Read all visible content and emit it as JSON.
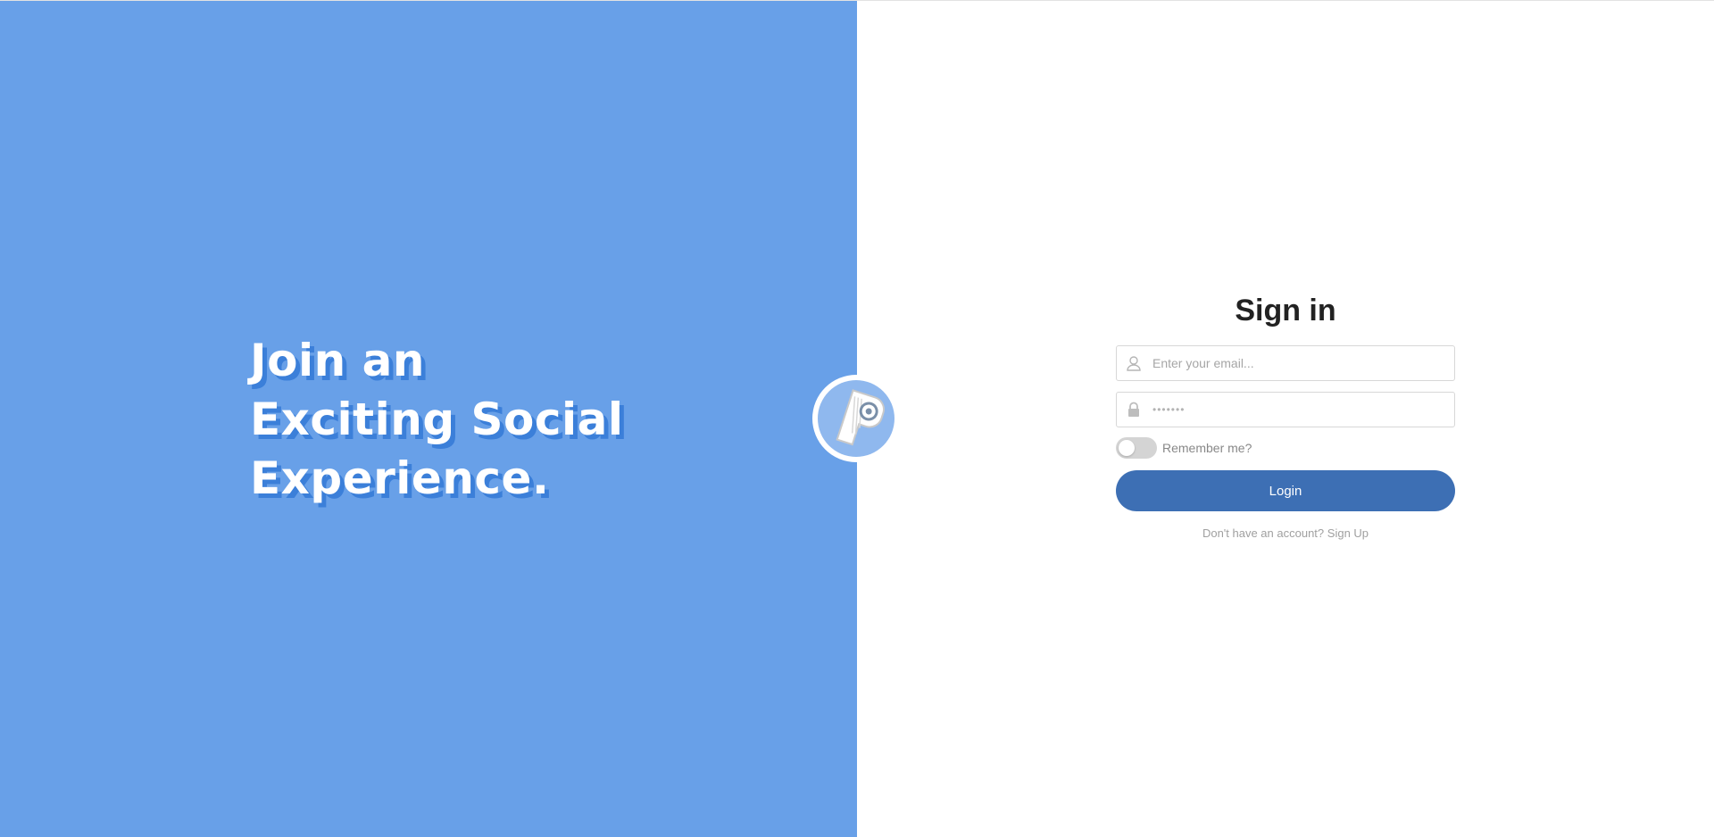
{
  "hero": {
    "line1": "Join an",
    "line2": "Exciting Social",
    "line3": "Experience."
  },
  "colors": {
    "left_panel": "#68a0e8",
    "headline_shadow": "#3b7fd9",
    "login_button": "#3d6fb4",
    "toggle_off": "#d4d4d4"
  },
  "logo": {
    "icon": "key-logo-icon"
  },
  "signin": {
    "title": "Sign in",
    "email": {
      "placeholder": "Enter your email...",
      "value": "",
      "icon": "user-icon"
    },
    "password": {
      "value_masked": "•••••••",
      "icon": "lock-icon"
    },
    "remember": {
      "label": "Remember me?",
      "checked": false
    },
    "login_label": "Login",
    "signup_prompt": "Don't have an account?",
    "signup_link": "Sign Up"
  }
}
